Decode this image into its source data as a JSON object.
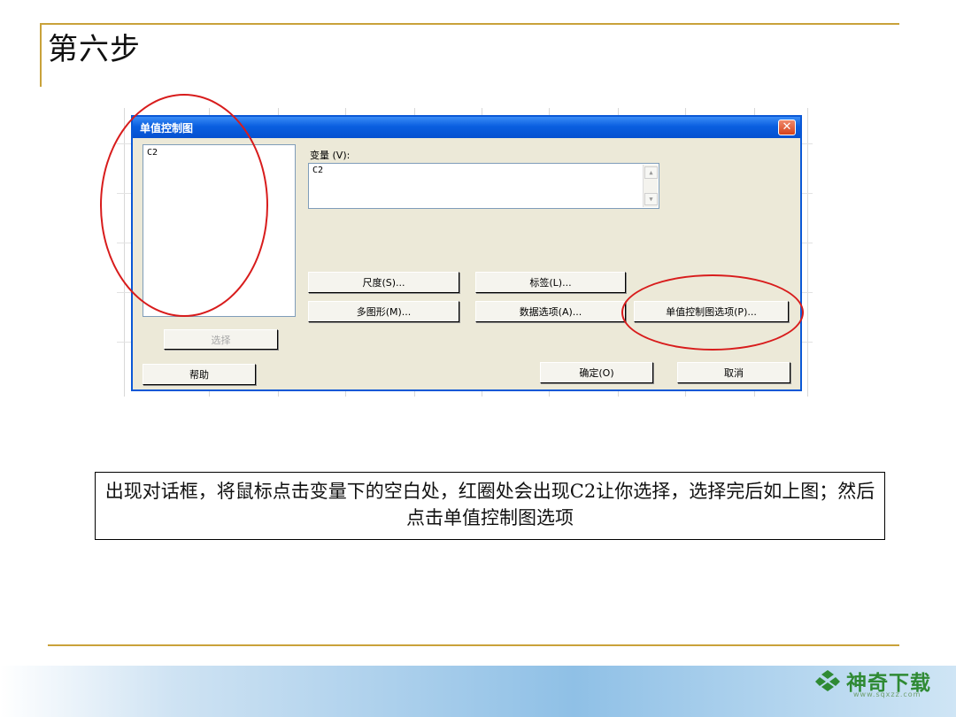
{
  "slide": {
    "title": "第六步",
    "caption": "出现对话框，将鼠标点击变量下的空白处，红圈处会出现C2让你选择，选择完后如上图；然后点击单值控制图选项"
  },
  "dialog": {
    "title": "单值控制图",
    "close_glyph": "✕",
    "variable_list": [
      "C2"
    ],
    "variable_label": "变量 (V):",
    "variable_value": "C2",
    "select_button": "选择",
    "help_button": "帮助",
    "scale_button": "尺度(S)...",
    "labels_button": "标签(L)...",
    "multigraph_button": "多图形(M)...",
    "data_options_button": "数据选项(A)...",
    "imr_options_button": "单值控制图选项(P)...",
    "ok_button": "确定(O)",
    "cancel_button": "取消"
  },
  "footer": {
    "brand_name": "神奇下载",
    "brand_url": "www.sqxzz.com"
  },
  "colors": {
    "accent_rule": "#c9a23a",
    "titlebar_blue": "#0a5fe0",
    "highlight_red": "#d81c1c",
    "brand_green": "#2f8a34"
  }
}
